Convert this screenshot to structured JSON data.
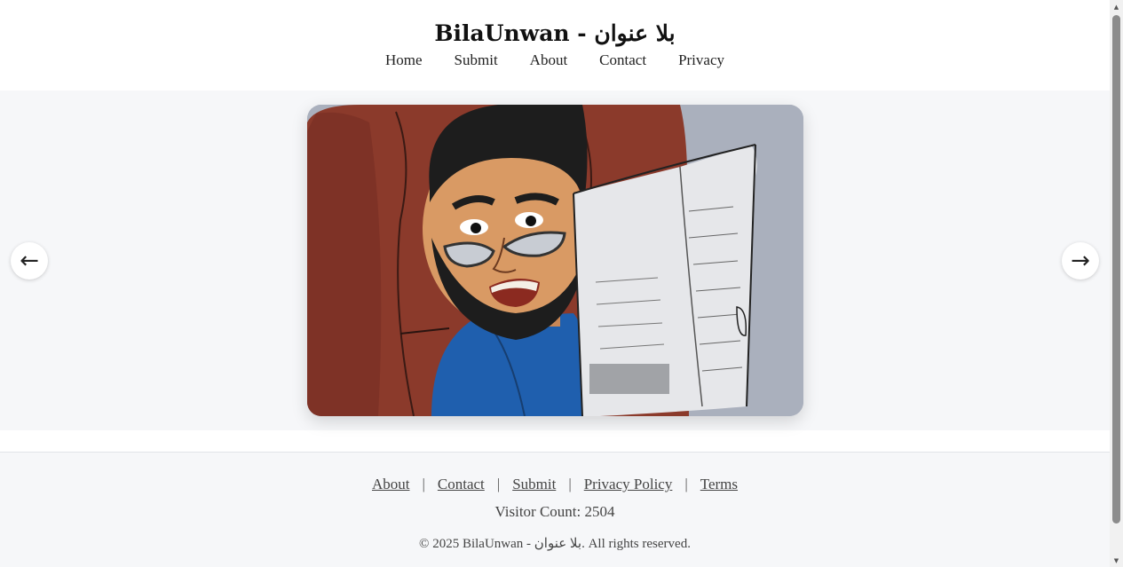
{
  "header": {
    "title": "BilaUnwan - بلا عنوان",
    "nav": [
      "Home",
      "Submit",
      "About",
      "Contact",
      "Privacy"
    ]
  },
  "carousel": {
    "prev_icon": "←",
    "next_icon": "→",
    "slide_icon": "drawing-of-bearded-man-reading-newspaper"
  },
  "footer": {
    "links": [
      "About",
      "Contact",
      "Submit",
      "Privacy Policy",
      "Terms"
    ],
    "separator": "|",
    "visitor_count": "Visitor Count: 2504",
    "copyright": "© 2025 BilaUnwan - بلا عنوان. All rights reserved."
  },
  "colors": {
    "section_bg": "#f6f7f9",
    "chair": "#8a3a2c",
    "shirt": "#1f5fae",
    "skin": "#d99a64"
  }
}
